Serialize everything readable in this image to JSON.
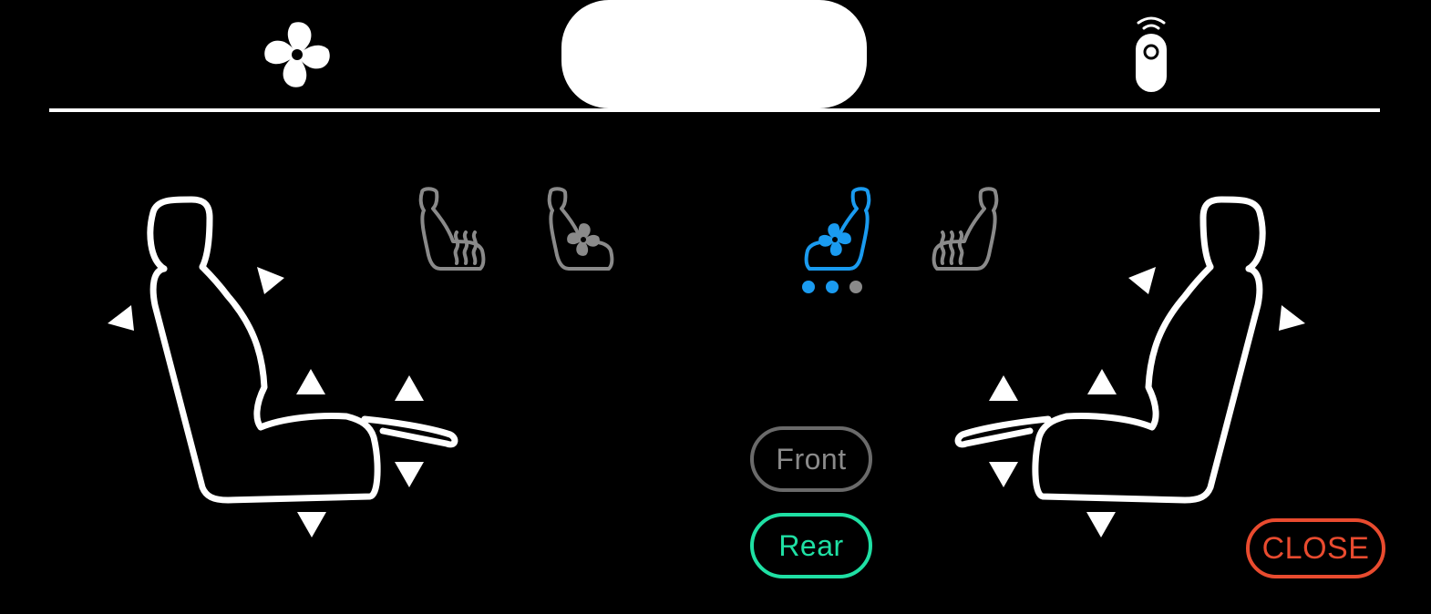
{
  "app": {
    "tabs": [
      {
        "name": "fan",
        "icon": "fan-icon",
        "active": false
      },
      {
        "name": "seat",
        "icon": "seat-icon",
        "active": true
      },
      {
        "name": "remote",
        "icon": "remote-icon",
        "active": false
      }
    ]
  },
  "seat_functions": {
    "left_heat": {
      "icon": "seat-heat-icon",
      "state": "off"
    },
    "left_vent": {
      "icon": "seat-ventilation-icon",
      "state": "off"
    },
    "right_vent": {
      "icon": "seat-ventilation-icon",
      "state": "on",
      "level": 2,
      "max_level": 3
    },
    "right_heat": {
      "icon": "seat-heat-icon",
      "state": "off"
    }
  },
  "row_selector": {
    "front_label": "Front",
    "rear_label": "Rear",
    "selected": "Rear"
  },
  "close_label": "CLOSE",
  "colors": {
    "background": "#000000",
    "foreground": "#ffffff",
    "inactive": "#8a8a8a",
    "active_blue": "#1a9bf0",
    "selected_green": "#1fe0a4",
    "close_red": "#e94b2f"
  }
}
